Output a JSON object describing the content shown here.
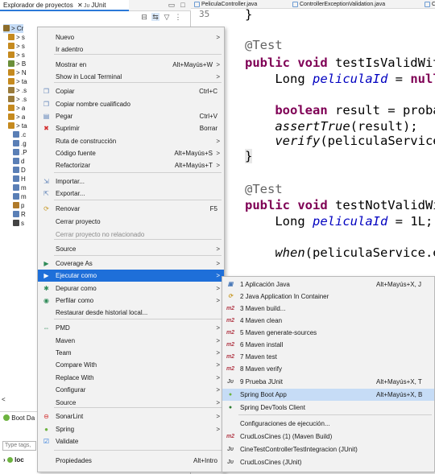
{
  "left_panel": {
    "tabs": [
      {
        "label": "Explorador de proyectos",
        "close": "✕"
      },
      {
        "label": "JUnit"
      }
    ],
    "tree_rows": [
      {
        "text": "> Cr"
      },
      {
        "text": "> s"
      },
      {
        "text": "> s"
      },
      {
        "text": "> s"
      },
      {
        "text": "> B"
      },
      {
        "text": "> N"
      },
      {
        "text": "> ta"
      },
      {
        "text": "> .s"
      },
      {
        "text": "> .s"
      },
      {
        "text": "> a"
      },
      {
        "text": "> a"
      },
      {
        "text": "> ta"
      },
      {
        "text": ".c"
      },
      {
        "text": ".g"
      },
      {
        "text": ".P"
      },
      {
        "text": "d"
      },
      {
        "text": "D"
      },
      {
        "text": "H"
      },
      {
        "text": "m"
      },
      {
        "text": "m"
      },
      {
        "text": "p"
      },
      {
        "text": "R"
      },
      {
        "text": "s"
      }
    ],
    "boot_dash": {
      "title": "Boot Da",
      "filter_placeholder": "Type tags,",
      "item": "loc"
    }
  },
  "editor": {
    "tabs": [
      {
        "label": "PeliculaController.java"
      },
      {
        "label": "ControllerExceptionValidation.java"
      },
      {
        "label": "C"
      }
    ],
    "line_number": "35"
  },
  "context_menu": {
    "items": [
      {
        "label": "Nuevo",
        "submenu": true
      },
      {
        "label": "Ir adentro"
      },
      {
        "label": "Mostrar en",
        "accel": "Alt+Mayús+W",
        "submenu": true
      },
      {
        "label": "Show in Local Terminal",
        "submenu": true
      },
      {
        "label": "Copiar",
        "accel": "Ctrl+C"
      },
      {
        "label": "Copiar nombre cualificado"
      },
      {
        "label": "Pegar",
        "accel": "Ctrl+V"
      },
      {
        "label": "Suprimir",
        "accel": "Borrar"
      },
      {
        "label": "Ruta de construcción",
        "submenu": true
      },
      {
        "label": "Código fuente",
        "accel": "Alt+Mayús+S",
        "submenu": true
      },
      {
        "label": "Refactorizar",
        "accel": "Alt+Mayús+T",
        "submenu": true
      },
      {
        "label": "Importar..."
      },
      {
        "label": "Exportar..."
      },
      {
        "label": "Renovar",
        "accel": "F5"
      },
      {
        "label": "Cerrar proyecto"
      },
      {
        "label": "Cerrar proyecto no relacionado"
      },
      {
        "label": "Source",
        "submenu": true
      },
      {
        "label": "Coverage As",
        "submenu": true
      },
      {
        "label": "Ejecutar como",
        "submenu": true
      },
      {
        "label": "Depurar como",
        "submenu": true
      },
      {
        "label": "Perfilar como",
        "submenu": true
      },
      {
        "label": "Restaurar desde historial local..."
      },
      {
        "label": "PMD",
        "submenu": true
      },
      {
        "label": "Maven",
        "submenu": true
      },
      {
        "label": "Team",
        "submenu": true
      },
      {
        "label": "Compare With",
        "submenu": true
      },
      {
        "label": "Replace With",
        "submenu": true
      },
      {
        "label": "Configurar",
        "submenu": true
      },
      {
        "label": "Source",
        "submenu": true
      },
      {
        "label": "SonarLint",
        "submenu": true
      },
      {
        "label": "Spring",
        "submenu": true
      },
      {
        "label": "Validate"
      },
      {
        "label": "Propiedades",
        "accel": "Alt+Intro"
      }
    ],
    "arrow": ">"
  },
  "submenu": {
    "items": [
      {
        "label": "1 Aplicación Java",
        "accel": "Alt+Mayús+X, J"
      },
      {
        "label": "2 Java Application In Container"
      },
      {
        "label": "3 Maven build..."
      },
      {
        "label": "4 Maven clean"
      },
      {
        "label": "5 Maven generate-sources"
      },
      {
        "label": "6 Maven install"
      },
      {
        "label": "7 Maven test"
      },
      {
        "label": "8 Maven verify"
      },
      {
        "label": "9 Prueba JUnit",
        "accel": "Alt+Mayús+X, T"
      },
      {
        "label": "Spring Boot App",
        "accel": "Alt+Mayús+X, B"
      },
      {
        "label": "Spring DevTools Client"
      },
      {
        "label": "Configuraciones de ejecución..."
      },
      {
        "label": "CrudLosCines (1) (Maven Build)"
      },
      {
        "label": "CineTestControllerTestIntegracion (JUnit)"
      },
      {
        "label": "CrudLosCines (JUnit)"
      }
    ],
    "icon_m2": "m2",
    "icon_ju": "Jᴜ"
  },
  "code": {
    "brace_close": "}",
    "ann1": "@Test",
    "line1_kw": "public void ",
    "line1_name": "testIsValidWit",
    "line2_a": "    Long ",
    "line2_var": "peliculaId",
    "line2_b": " = ",
    "line2_kw": "null",
    "line3_kw": "    boolean ",
    "line3_rest": "result = proba",
    "line4_it": "    assertTrue",
    "line4_rest": "(result);",
    "line5_it": "    verify",
    "line5_rest": "(peliculaService",
    "brace2": "}",
    "ann2": "@Test",
    "line6_kw": "public void ",
    "line6_name": "testNotValidWi",
    "line7_a": "    Long ",
    "line7_var": "peliculaId",
    "line7_b": " = 1L;",
    "line8_it": "    when",
    "line8_rest": "(peliculaService.e"
  },
  "colors": {
    "highlight": "#1e6fd9",
    "selection": "#c6dcf6",
    "keyword": "#7f0055",
    "field": "#0000c0"
  }
}
